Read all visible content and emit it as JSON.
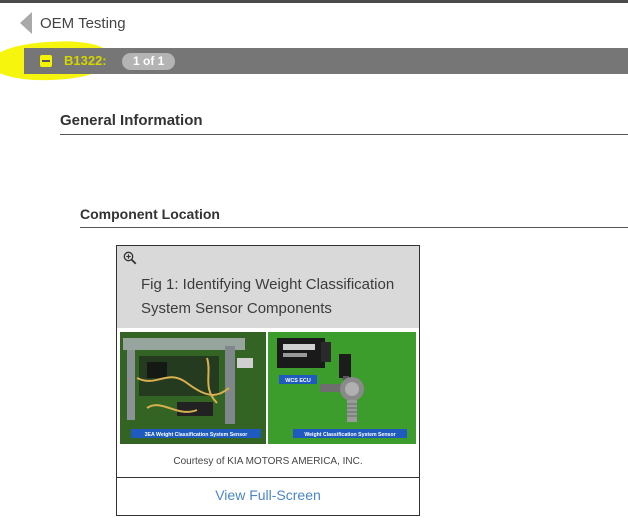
{
  "nav": {
    "back_label": "OEM Testing"
  },
  "code_bar": {
    "code": "B1322:",
    "pager": "1 of 1"
  },
  "sections": {
    "general": "General Information",
    "component": "Component Location"
  },
  "figure": {
    "title": "Fig 1: Identifying Weight Classification System Sensor Components",
    "left_label": "3EA Weight Classification System Sensor",
    "ecu_label": "WCS ECU",
    "right_label": "Weight Classification System Sensor",
    "credit": "Courtesy of KIA MOTORS AMERICA, INC.",
    "view_full_screen": "View Full-Screen"
  },
  "colors": {
    "highlight": "#f4f400",
    "bar": "#767676",
    "link": "#4a86c5"
  }
}
